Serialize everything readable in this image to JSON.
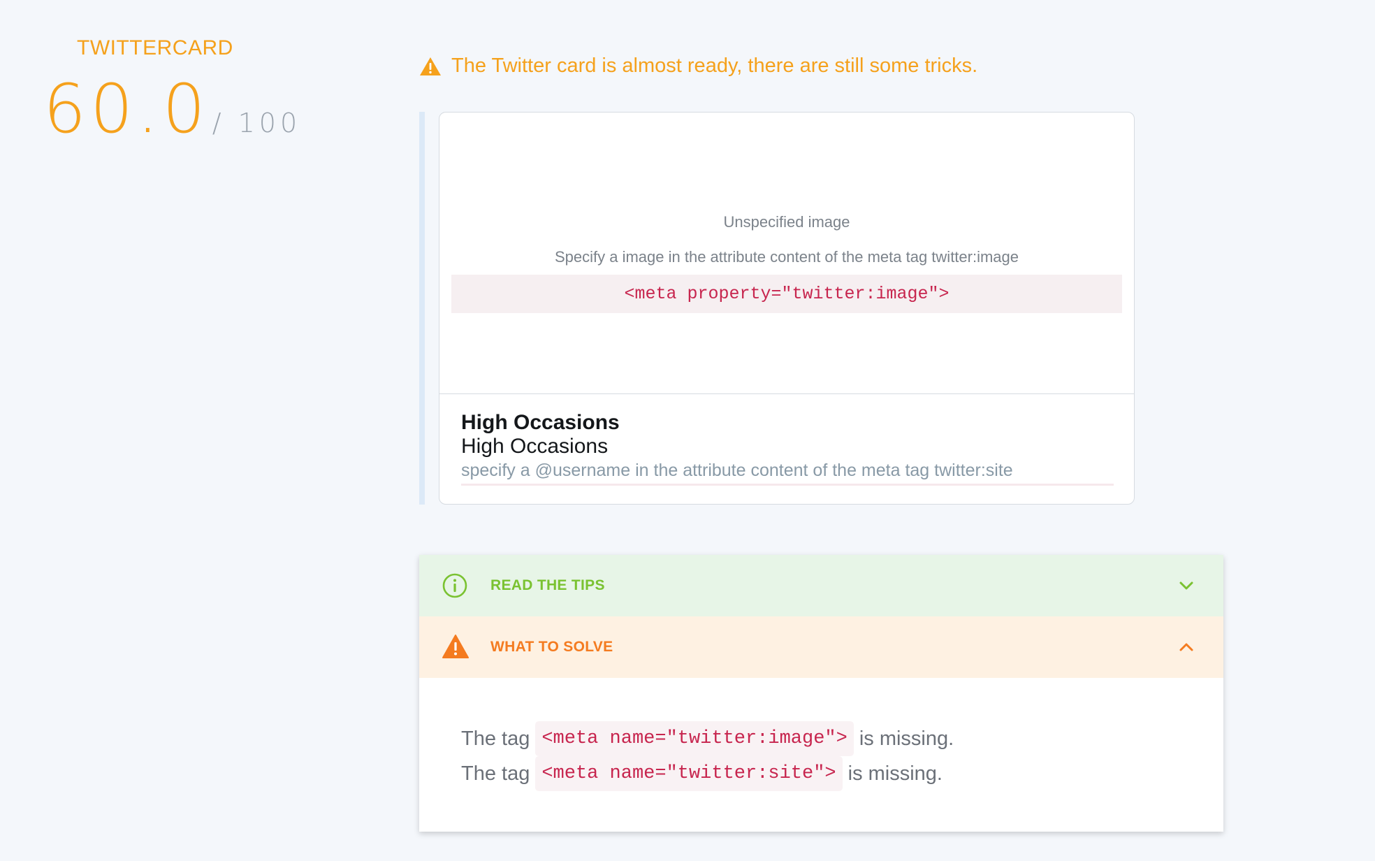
{
  "score": {
    "label": "TWITTERCARD",
    "value": "60.0",
    "max": "/ 100"
  },
  "warning": {
    "text": "The Twitter card is almost ready, there are still some tricks.",
    "icon": "warning-triangle-icon",
    "color": "#f5a11c"
  },
  "card": {
    "image": {
      "title": "Unspecified image",
      "hint": "Specify a image in the attribute content of the meta tag twitter:image",
      "code": "<meta property=\"twitter:image\">"
    },
    "title": "High Occasions",
    "description": "High Occasions",
    "site_hint": "specify a @username in the attribute content of the meta tag twitter:site"
  },
  "accordion": {
    "tips": {
      "title": "READ THE TIPS",
      "icon": "info-circle-icon",
      "chevron": "chevron-down-icon",
      "color": "#7ac231"
    },
    "solve": {
      "title": "WHAT TO SOLVE",
      "icon": "warning-triangle-icon",
      "chevron": "chevron-up-icon",
      "color": "#f47b20",
      "issues": [
        {
          "prefix": "The tag",
          "code": "<meta name=\"twitter:image\">",
          "suffix": "is missing."
        },
        {
          "prefix": "The tag",
          "code": "<meta name=\"twitter:site\">",
          "suffix": "is missing."
        }
      ]
    }
  }
}
